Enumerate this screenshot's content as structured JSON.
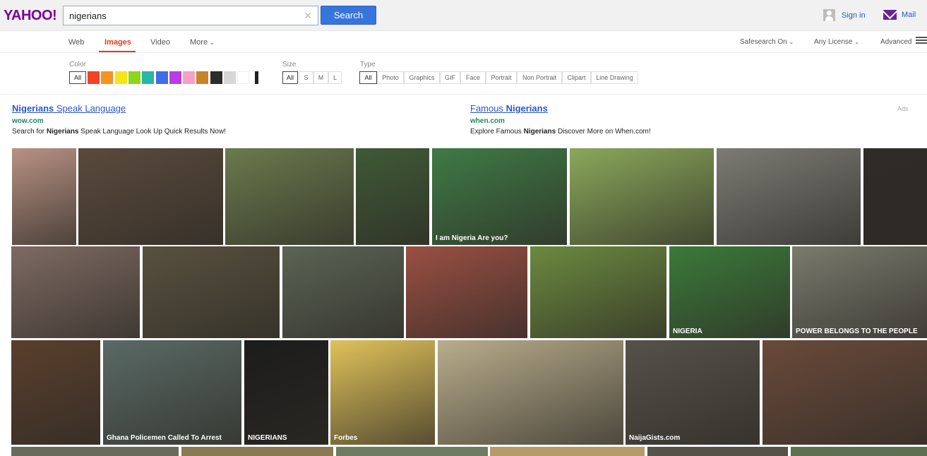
{
  "header": {
    "logo": "YAHOO!",
    "search_value": "nigerians",
    "search_button": "Search",
    "sign_in": "Sign in",
    "mail": "Mail"
  },
  "nav": {
    "tabs": [
      "Web",
      "Images",
      "Video",
      "More"
    ],
    "active_tab": "Images",
    "safesearch": "Safesearch On",
    "license": "Any License",
    "advanced": "Advanced"
  },
  "filters": {
    "color_label": "Color",
    "color_all": "All",
    "colors": [
      "#f2441f",
      "#f7941d",
      "#f2e51a",
      "#8cd61b",
      "#27b6a7",
      "#3f6ee8",
      "#bb3ce6",
      "#f7a0c7",
      "#c8842a",
      "#2b2b2b",
      "#d6d6d6",
      "#ffffff"
    ],
    "size_label": "Size",
    "sizes": [
      "All",
      "S",
      "M",
      "L"
    ],
    "type_label": "Type",
    "types": [
      "All",
      "Photo",
      "Graphics",
      "GIF",
      "Face",
      "Portrait",
      "Non Portrait",
      "Clipart",
      "Line Drawing"
    ]
  },
  "ads": {
    "label": "Ads",
    "items": [
      {
        "title_bold": "Nigerians",
        "title_rest": " Speak Language",
        "url": "wow.com",
        "desc_pre": "Search for ",
        "desc_bold": "Nigerians",
        "desc_post": " Speak Language Look Up Quick Results Now!"
      },
      {
        "title_rest": "Famous ",
        "title_bold": "Nigerians",
        "url": "when.com",
        "desc_pre": "Explore Famous ",
        "desc_bold": "Nigerians",
        "desc_post": " Discover More on When.com!"
      }
    ]
  },
  "images": {
    "row1": [
      {
        "name": "img-man-bleeding",
        "color": "#b89283"
      },
      {
        "name": "img-riot-fire",
        "color": "#5a4a3c"
      },
      {
        "name": "img-selfie-valley",
        "color": "#6a7a4d"
      },
      {
        "name": "img-woman-dress",
        "color": "#3f5a36"
      },
      {
        "name": "img-nigeria-fans",
        "color": "#3f7a45",
        "caption": "I am Nigeria   Are you?"
      },
      {
        "name": "img-woman-headwrap",
        "color": "#8aa85a"
      },
      {
        "name": "img-man-suit-flag",
        "color": "#7b7b74"
      },
      {
        "name": "img-jonathan-hat",
        "color": "#2f2b27"
      }
    ],
    "row2": [
      {
        "name": "img-man-phone",
        "color": "#7e6a63"
      },
      {
        "name": "img-crowd",
        "color": "#59513f"
      },
      {
        "name": "img-escalator",
        "color": "#5b6455"
      },
      {
        "name": "img-supermarket",
        "color": "#9b4f43"
      },
      {
        "name": "img-women-cornfield",
        "color": "#6b8a3f"
      },
      {
        "name": "img-fan-scarf",
        "color": "#3b7a3a",
        "caption": "NIGERIA"
      },
      {
        "name": "img-protest-sign",
        "color": "#7a7a6e",
        "caption": "POWER BELONGS TO THE PEOPLE"
      }
    ],
    "row3": [
      {
        "name": "img-man-face-injured",
        "color": "#5a3f2c"
      },
      {
        "name": "img-ghana-police",
        "color": "#5a6a66",
        "caption": "Ghana Policemen Called To Arrest"
      },
      {
        "name": "img-nigerians-poster",
        "color": "#1c1c1c",
        "caption": "NIGERIANS"
      },
      {
        "name": "img-forbes-cartoon",
        "color": "#e0c25a",
        "caption": "Forbes"
      },
      {
        "name": "img-office-men",
        "color": "#b8ad8c"
      },
      {
        "name": "img-group-men",
        "color": "#55524a",
        "caption": "NaijaGists.com"
      },
      {
        "name": "img-man-lying",
        "color": "#6a4a3a"
      }
    ]
  }
}
